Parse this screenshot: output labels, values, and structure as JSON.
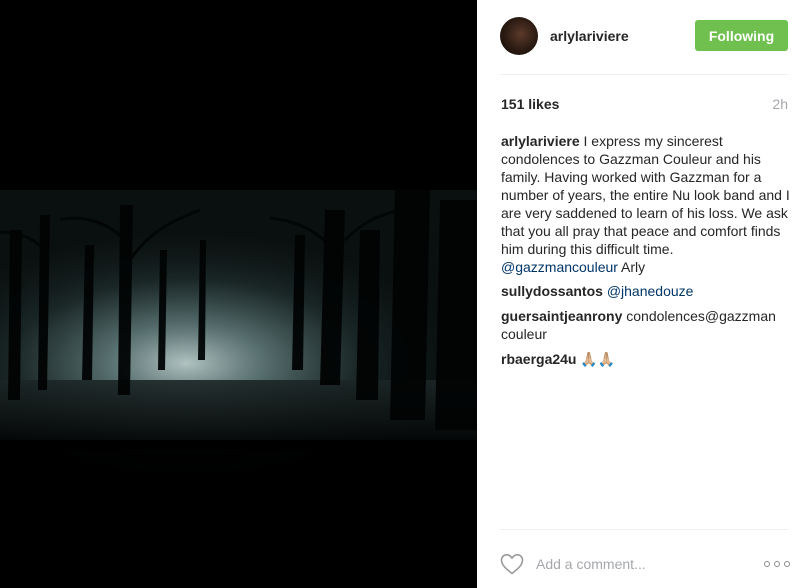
{
  "post": {
    "username": "arlylariviere",
    "follow_label": "Following",
    "likes": "151 likes",
    "time": "2h"
  },
  "caption": {
    "username": "arlylariviere",
    "text": " I express my sincerest condolences to Gazzman Couleur and his family. Having worked with Gazzman for a number of years, the entire Nu look band and I are very saddened to learn of his loss. We ask that you all pray that peace and comfort finds him during this difficult time. ",
    "mention": "@gazzmancouleur",
    "text_after": " Arly"
  },
  "comments": [
    {
      "username": "sullydossantos",
      "mention": "@jhanedouze",
      "text": ""
    },
    {
      "username": "guersaintjeanrony",
      "mention": "",
      "text": " condolences@gazzman couleur"
    },
    {
      "username": "rbaerga24u",
      "mention": "",
      "text": " 🙏🏼🙏🏼"
    }
  ],
  "comment_box": {
    "placeholder": "Add a comment..."
  },
  "icons": {
    "like": "heart-icon",
    "more": "more-options-icon"
  },
  "colors": {
    "follow_button": "#70c050",
    "mention": "#003569",
    "muted": "#a5a7aa"
  }
}
